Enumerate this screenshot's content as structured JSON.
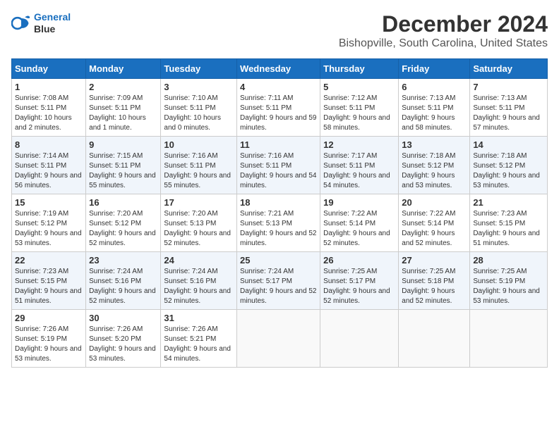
{
  "logo": {
    "line1": "General",
    "line2": "Blue"
  },
  "title": "December 2024",
  "location": "Bishopville, South Carolina, United States",
  "weekdays": [
    "Sunday",
    "Monday",
    "Tuesday",
    "Wednesday",
    "Thursday",
    "Friday",
    "Saturday"
  ],
  "weeks": [
    [
      {
        "day": "1",
        "rise": "7:08 AM",
        "set": "5:11 PM",
        "daylight": "10 hours and 2 minutes."
      },
      {
        "day": "2",
        "rise": "7:09 AM",
        "set": "5:11 PM",
        "daylight": "10 hours and 1 minute."
      },
      {
        "day": "3",
        "rise": "7:10 AM",
        "set": "5:11 PM",
        "daylight": "10 hours and 0 minutes."
      },
      {
        "day": "4",
        "rise": "7:11 AM",
        "set": "5:11 PM",
        "daylight": "9 hours and 59 minutes."
      },
      {
        "day": "5",
        "rise": "7:12 AM",
        "set": "5:11 PM",
        "daylight": "9 hours and 58 minutes."
      },
      {
        "day": "6",
        "rise": "7:13 AM",
        "set": "5:11 PM",
        "daylight": "9 hours and 58 minutes."
      },
      {
        "day": "7",
        "rise": "7:13 AM",
        "set": "5:11 PM",
        "daylight": "9 hours and 57 minutes."
      }
    ],
    [
      {
        "day": "8",
        "rise": "7:14 AM",
        "set": "5:11 PM",
        "daylight": "9 hours and 56 minutes."
      },
      {
        "day": "9",
        "rise": "7:15 AM",
        "set": "5:11 PM",
        "daylight": "9 hours and 55 minutes."
      },
      {
        "day": "10",
        "rise": "7:16 AM",
        "set": "5:11 PM",
        "daylight": "9 hours and 55 minutes."
      },
      {
        "day": "11",
        "rise": "7:16 AM",
        "set": "5:11 PM",
        "daylight": "9 hours and 54 minutes."
      },
      {
        "day": "12",
        "rise": "7:17 AM",
        "set": "5:11 PM",
        "daylight": "9 hours and 54 minutes."
      },
      {
        "day": "13",
        "rise": "7:18 AM",
        "set": "5:12 PM",
        "daylight": "9 hours and 53 minutes."
      },
      {
        "day": "14",
        "rise": "7:18 AM",
        "set": "5:12 PM",
        "daylight": "9 hours and 53 minutes."
      }
    ],
    [
      {
        "day": "15",
        "rise": "7:19 AM",
        "set": "5:12 PM",
        "daylight": "9 hours and 53 minutes."
      },
      {
        "day": "16",
        "rise": "7:20 AM",
        "set": "5:12 PM",
        "daylight": "9 hours and 52 minutes."
      },
      {
        "day": "17",
        "rise": "7:20 AM",
        "set": "5:13 PM",
        "daylight": "9 hours and 52 minutes."
      },
      {
        "day": "18",
        "rise": "7:21 AM",
        "set": "5:13 PM",
        "daylight": "9 hours and 52 minutes."
      },
      {
        "day": "19",
        "rise": "7:22 AM",
        "set": "5:14 PM",
        "daylight": "9 hours and 52 minutes."
      },
      {
        "day": "20",
        "rise": "7:22 AM",
        "set": "5:14 PM",
        "daylight": "9 hours and 52 minutes."
      },
      {
        "day": "21",
        "rise": "7:23 AM",
        "set": "5:15 PM",
        "daylight": "9 hours and 51 minutes."
      }
    ],
    [
      {
        "day": "22",
        "rise": "7:23 AM",
        "set": "5:15 PM",
        "daylight": "9 hours and 51 minutes."
      },
      {
        "day": "23",
        "rise": "7:24 AM",
        "set": "5:16 PM",
        "daylight": "9 hours and 52 minutes."
      },
      {
        "day": "24",
        "rise": "7:24 AM",
        "set": "5:16 PM",
        "daylight": "9 hours and 52 minutes."
      },
      {
        "day": "25",
        "rise": "7:24 AM",
        "set": "5:17 PM",
        "daylight": "9 hours and 52 minutes."
      },
      {
        "day": "26",
        "rise": "7:25 AM",
        "set": "5:17 PM",
        "daylight": "9 hours and 52 minutes."
      },
      {
        "day": "27",
        "rise": "7:25 AM",
        "set": "5:18 PM",
        "daylight": "9 hours and 52 minutes."
      },
      {
        "day": "28",
        "rise": "7:25 AM",
        "set": "5:19 PM",
        "daylight": "9 hours and 53 minutes."
      }
    ],
    [
      {
        "day": "29",
        "rise": "7:26 AM",
        "set": "5:19 PM",
        "daylight": "9 hours and 53 minutes."
      },
      {
        "day": "30",
        "rise": "7:26 AM",
        "set": "5:20 PM",
        "daylight": "9 hours and 53 minutes."
      },
      {
        "day": "31",
        "rise": "7:26 AM",
        "set": "5:21 PM",
        "daylight": "9 hours and 54 minutes."
      },
      null,
      null,
      null,
      null
    ]
  ]
}
